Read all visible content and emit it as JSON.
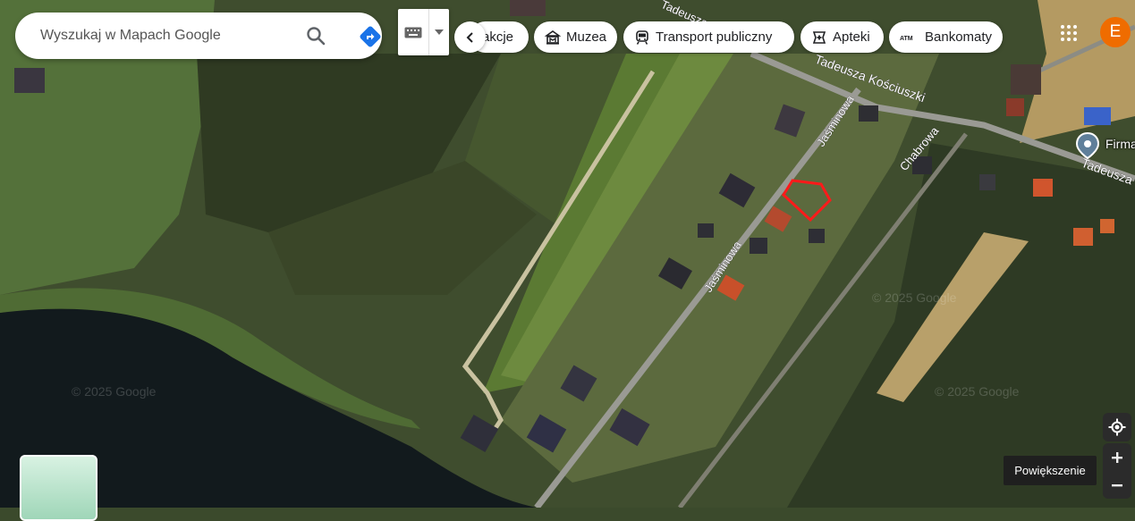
{
  "search": {
    "placeholder": "Wyszukaj w Mapach Google"
  },
  "chips": [
    {
      "label": "akcje",
      "icon": "truncated-chip"
    },
    {
      "label": "Muzea",
      "icon": "museum-icon"
    },
    {
      "label": "Transport publiczny",
      "icon": "train-icon"
    },
    {
      "label": "Apteki",
      "icon": "pharmacy-icon"
    },
    {
      "label": "Bankomaty",
      "icon": "atm-icon"
    }
  ],
  "account": {
    "initial": "E"
  },
  "streets": {
    "kosciuszki": "Tadeusza Kościuszki",
    "kosciuszki_top": "Tadeusza K",
    "kosciuszki_right": "Tadeusza",
    "jasminowa_1": "Jaśminowa",
    "jasminowa_2": "Jaśminowa",
    "chabrowa": "Chabrowa"
  },
  "place": {
    "label": "Firma"
  },
  "watermark": "© 2025 Google",
  "zoom": {
    "tooltip": "Powiększenie"
  },
  "colors": {
    "accent_blue": "#1a73e8",
    "avatar": "#ef6c00",
    "parcel_outline": "#ff1a1a"
  }
}
